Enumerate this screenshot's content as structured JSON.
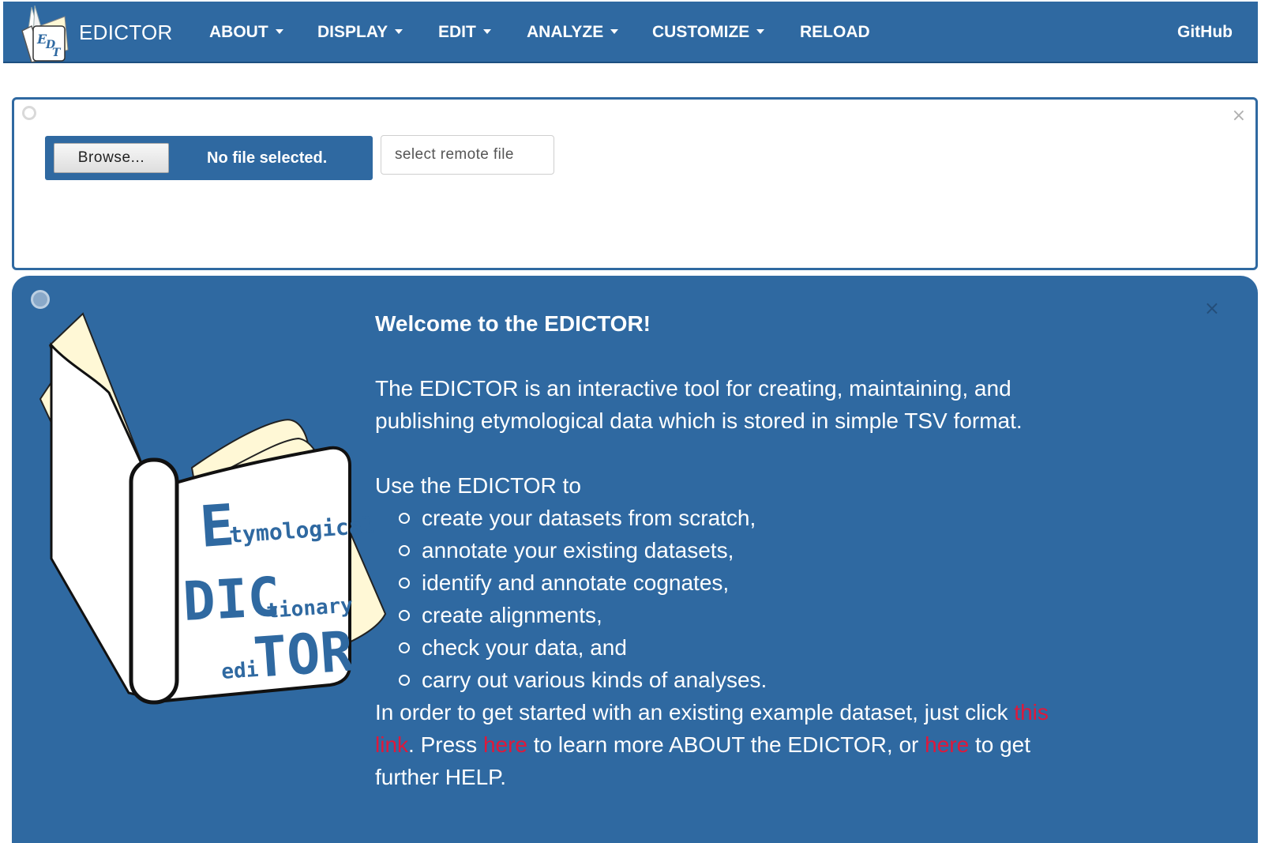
{
  "navbar": {
    "brand": "EDICTOR",
    "logo_letters": "EDT",
    "items": [
      {
        "label": "ABOUT",
        "dropdown": true
      },
      {
        "label": "DISPLAY",
        "dropdown": true
      },
      {
        "label": "EDIT",
        "dropdown": true
      },
      {
        "label": "ANALYZE",
        "dropdown": true
      },
      {
        "label": "CUSTOMIZE",
        "dropdown": true
      },
      {
        "label": "RELOAD",
        "dropdown": false
      }
    ],
    "github": "GitHub"
  },
  "file_panel": {
    "browse_label": "Browse...",
    "file_status": "No file selected.",
    "remote_placeholder": "select remote file",
    "close": "×"
  },
  "welcome": {
    "close": "×",
    "logo": {
      "line1_big": "E",
      "line1_small": "tymological",
      "line2_big": "DIC",
      "line2_small": "tionary",
      "line3_small": "edi",
      "line3_big": "TOR"
    },
    "title": "Welcome to the EDICTOR!",
    "intro": "The EDICTOR is an interactive tool for creating, maintaining, and publishing etymological data which is stored in simple TSV format.",
    "use_heading": "Use the EDICTOR to",
    "uses": [
      "create your datasets from scratch,",
      "annotate your existing datasets,",
      "identify and annotate cognates,",
      "create alignments,",
      "check your data, and",
      "carry out various kinds of analyses."
    ],
    "outro": {
      "part1": "In order to get started with an existing example dataset, just click ",
      "link1": "this link",
      "part2": ". Press ",
      "link2": "here",
      "part3": " to learn more ABOUT the EDICTOR, or ",
      "link3": "here",
      "part4": " to get further HELP."
    },
    "colors": {
      "panel": "#2f69a1",
      "link": "#e0183a",
      "book_page": "#fff8d6"
    }
  }
}
